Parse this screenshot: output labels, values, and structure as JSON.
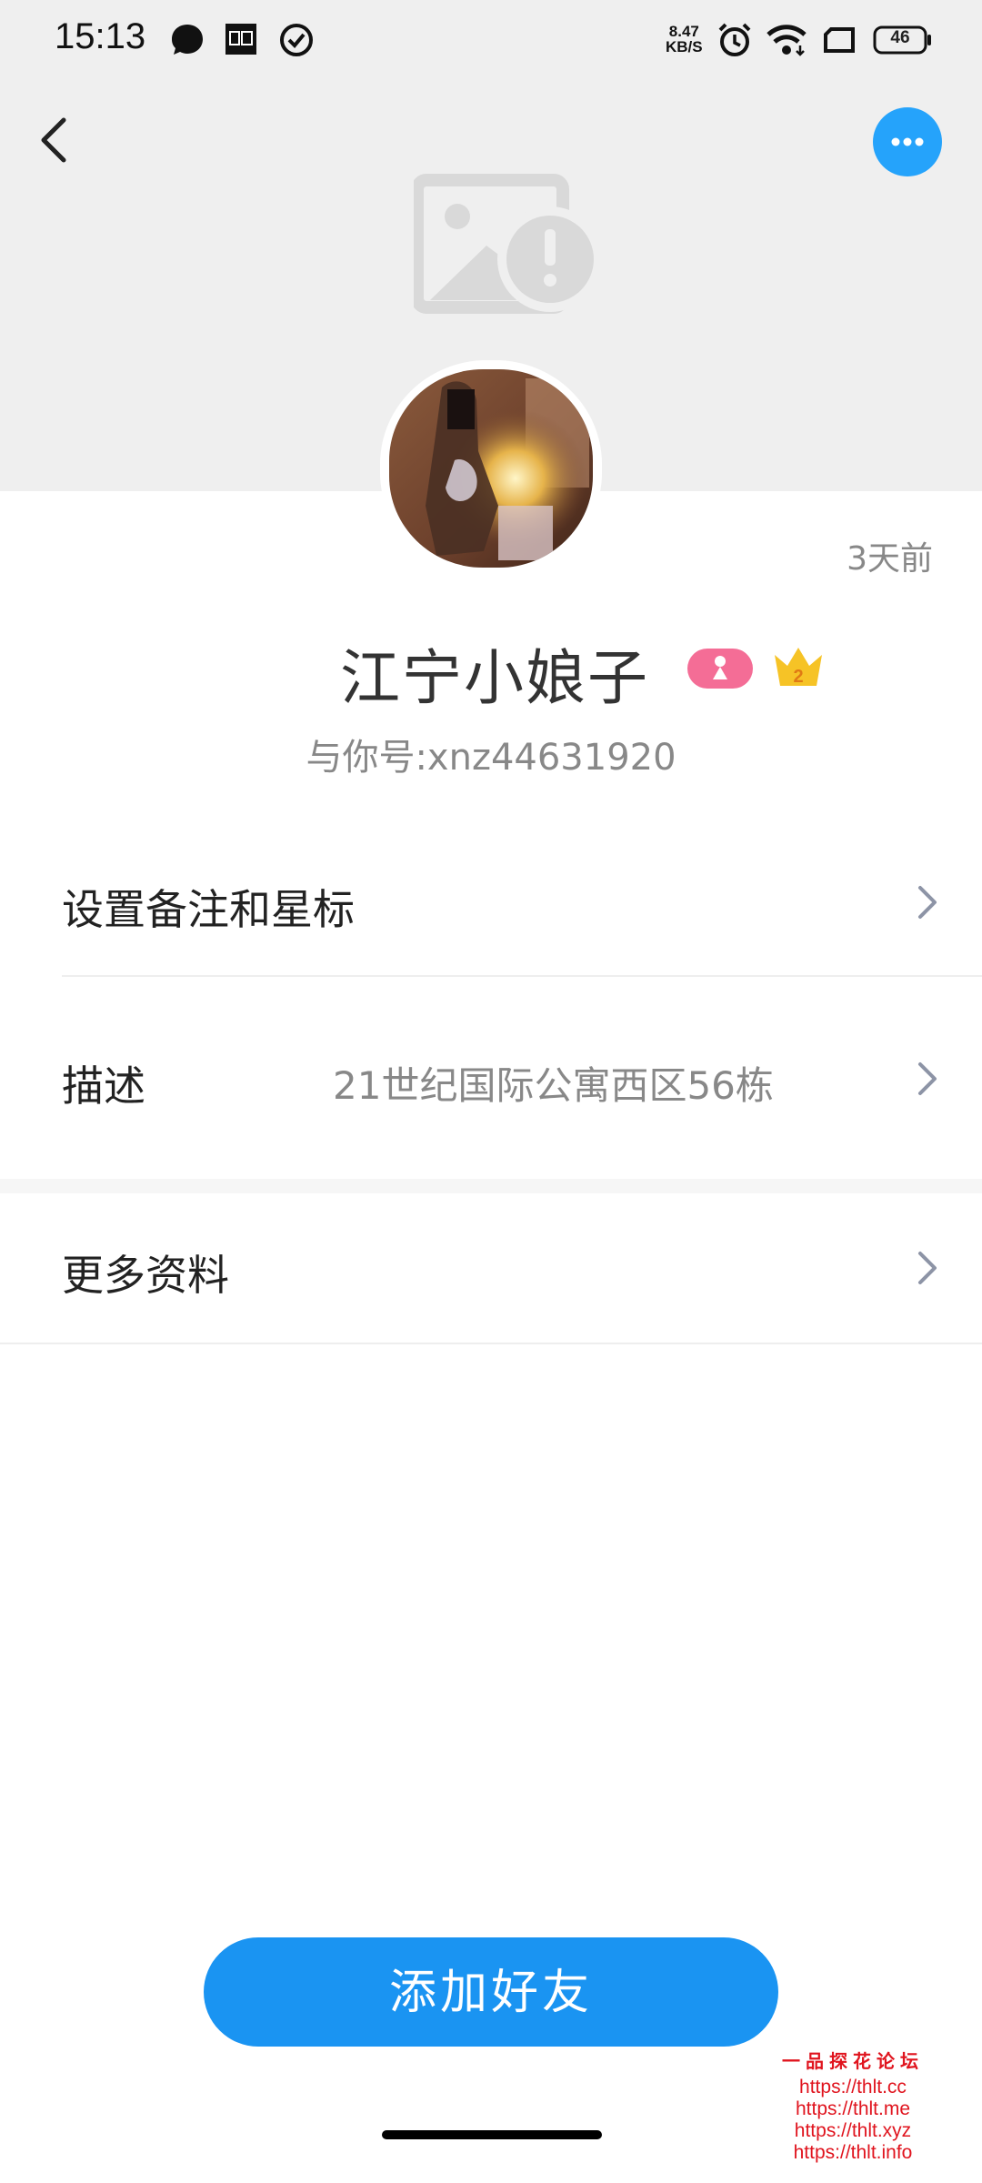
{
  "status_bar": {
    "time": "15:13",
    "net_speed_value": "8.47",
    "net_speed_unit": "KB/S",
    "battery": "46",
    "icons": [
      "chat-bubble-icon",
      "app-box-icon",
      "check-circle-icon",
      "alarm-icon",
      "wifi-icon",
      "screen-rotate-icon",
      "battery-icon"
    ]
  },
  "profile": {
    "last_seen": "3天前",
    "nickname": "江宁小娘子",
    "account_id": "与你号:xnz44631920",
    "crown_level": "2",
    "colors": {
      "accent": "#1a94f2",
      "more_button": "#25a3fb",
      "gender_badge": "#f46d96",
      "crown": "#f6c326"
    }
  },
  "rows": [
    {
      "label": "设置备注和星标",
      "value": ""
    },
    {
      "label": "描述",
      "value": "21世纪国际公寓西区56栋"
    },
    {
      "label": "更多资料",
      "value": ""
    }
  ],
  "action": {
    "add_friend_label": "添加好友"
  },
  "watermark": {
    "title": "一品探花论坛",
    "urls": [
      "https://thlt.cc",
      "https://thlt.me",
      "https://thlt.xyz",
      "https://thlt.info"
    ]
  }
}
